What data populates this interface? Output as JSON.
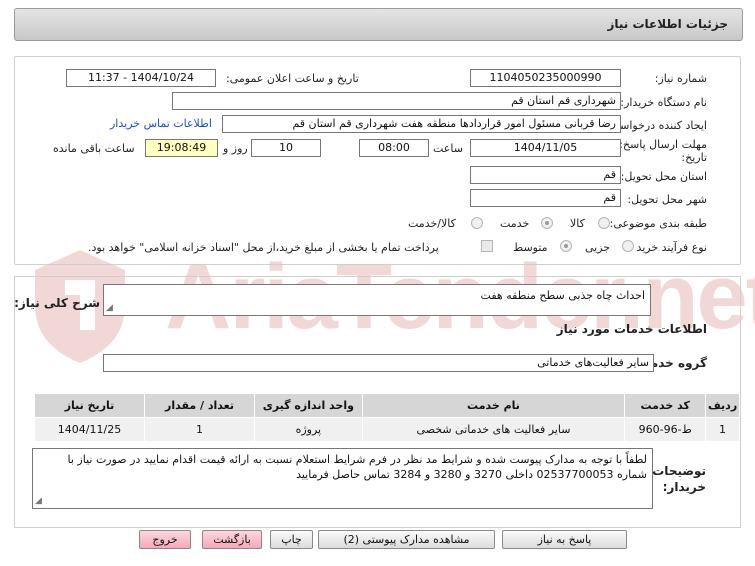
{
  "header": {
    "title": "جزئیات اطلاعات نیاز"
  },
  "form": {
    "need_number_label": "شماره نیاز:",
    "need_number": "1104050235000990",
    "announce_label": "تاریخ و ساعت اعلان عمومی:",
    "announce_value": "1404/10/24 - 11:37",
    "buyer_org_label": "نام دستگاه خریدار:",
    "buyer_org": "شهرداری قم استان قم",
    "creator_label": "ایجاد کننده درخواست:",
    "creator": "رضا قربانی مسئول امور قراردادها منطقه هفت شهرداری قم استان قم",
    "contact_link": "اطلاعات تماس خریدار",
    "deadline_label_1": "مهلت ارسال پاسخ: تا",
    "deadline_label_2": "تاریخ:",
    "deadline_date": "1404/11/05",
    "time_label": "ساعت",
    "deadline_time": "08:00",
    "days_value": "10",
    "days_label": "روز و",
    "remaining_time": "19:08:49",
    "remaining_label": "ساعت باقی مانده",
    "province_label": "استان محل تحویل:",
    "province": "قم",
    "city_label": "شهر محل تحویل:",
    "city": "قم",
    "category_label": "طبقه بندی موضوعی:",
    "category_options": [
      "کالا",
      "خدمت",
      "کالا/خدمت"
    ],
    "category_selected": "خدمت",
    "process_label": "نوع فرآیند خرید :",
    "process_options": [
      "جزیی",
      "متوسط"
    ],
    "process_selected": "متوسط",
    "payment_note": "پرداخت تمام یا بخشی از مبلغ خرید،از محل \"اسناد خزانه اسلامی\" خواهد بود."
  },
  "details": {
    "summary_label": "شرح کلی نیاز:",
    "summary": "احداث چاه جذبی سطح منطقه هفت",
    "services_title": "اطلاعات خدمات مورد نیاز",
    "service_group_label": "گروه خدمت:",
    "service_group": "سایر فعالیت‌های خدماتی",
    "table": {
      "headers": [
        "ردیف",
        "کد خدمت",
        "نام خدمت",
        "واحد اندازه گیری",
        "تعداد / مقدار",
        "تاریخ نیاز"
      ],
      "rows": [
        [
          "1",
          "ط-96-960",
          "سایر فعالیت های خدماتی شخصی",
          "پروژه",
          "1",
          "1404/11/25"
        ]
      ]
    },
    "buyer_notes_label_1": "توضیحات",
    "buyer_notes_label_2": "خریدار:",
    "buyer_notes": "لطفاً با توجه به مدارک پیوست شده و شرایط مد نظر در فرم شرایط استعلام نسبت به ارائه قیمت اقدام نمایید در صورت نیاز با شماره 02537700053 داخلی 3270 و 3280 و 3284 تماس حاصل فرمایید"
  },
  "buttons": {
    "reply": "پاسخ به نیاز",
    "attachments": "مشاهده مدارک پیوستی (2)",
    "print": "چاپ",
    "back": "بازگشت",
    "exit": "خروج"
  },
  "watermark": {
    "text": "AriaTender.net"
  },
  "colors": {
    "link": "#1a4fcc",
    "highlight": "#ffffc0",
    "pink_button": "#f4a9b8"
  }
}
